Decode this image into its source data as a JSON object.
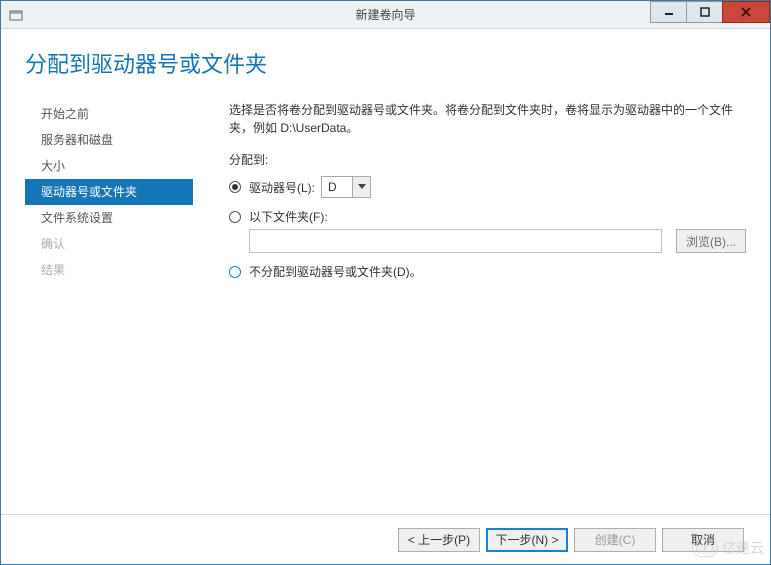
{
  "window": {
    "title": "新建卷向导"
  },
  "header": {
    "title": "分配到驱动器号或文件夹"
  },
  "sidebar": {
    "items": [
      {
        "label": "开始之前",
        "state": "done"
      },
      {
        "label": "服务器和磁盘",
        "state": "done"
      },
      {
        "label": "大小",
        "state": "done"
      },
      {
        "label": "驱动器号或文件夹",
        "state": "active"
      },
      {
        "label": "文件系统设置",
        "state": "done"
      },
      {
        "label": "确认",
        "state": "disabled"
      },
      {
        "label": "结果",
        "state": "disabled"
      }
    ]
  },
  "content": {
    "description": "选择是否将卷分配到驱动器号或文件夹。将卷分配到文件夹时，卷将显示为驱动器中的一个文件夹，例如 D:\\UserData。",
    "assign_label": "分配到:",
    "options": {
      "drive": {
        "label": "驱动器号(L):",
        "value": "D",
        "checked": true
      },
      "folder": {
        "label": "以下文件夹(F):",
        "path": "",
        "checked": false
      },
      "none": {
        "label": "不分配到驱动器号或文件夹(D)。",
        "checked": false
      }
    },
    "browse_button": "浏览(B)..."
  },
  "footer": {
    "prev": "< 上一步(P)",
    "next": "下一步(N) >",
    "create": "创建(C)",
    "cancel": "取消"
  },
  "watermark": {
    "text": "亿速云"
  }
}
